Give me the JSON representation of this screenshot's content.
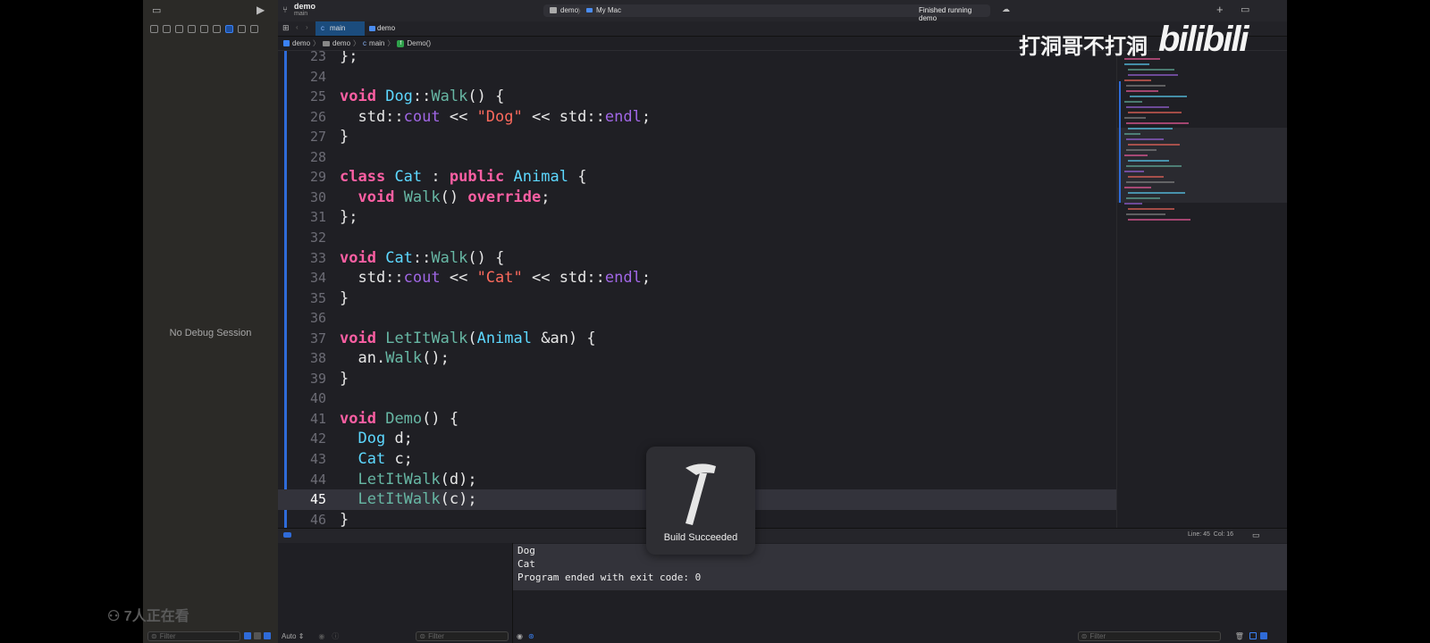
{
  "project": {
    "name": "demo",
    "branch": "main"
  },
  "toolbar": {
    "scheme": "demo",
    "destination": "My Mac",
    "status": "Finished running demo"
  },
  "tabs": [
    {
      "label": "main"
    },
    {
      "label": "demo"
    }
  ],
  "breadcrumb": [
    "demo",
    "demo",
    "main",
    "Demo()"
  ],
  "navigator": {
    "empty_message": "No Debug Session",
    "filter_placeholder": "Filter"
  },
  "editor": {
    "current_line": 45,
    "lines": [
      {
        "n": "23",
        "code": "};"
      },
      {
        "n": "24",
        "code": ""
      },
      {
        "n": "25",
        "code": "void Dog::Walk() {"
      },
      {
        "n": "26",
        "code": "  std::cout << \"Dog\" << std::endl;"
      },
      {
        "n": "27",
        "code": "}"
      },
      {
        "n": "28",
        "code": ""
      },
      {
        "n": "29",
        "code": "class Cat : public Animal {"
      },
      {
        "n": "30",
        "code": "  void Walk() override;"
      },
      {
        "n": "31",
        "code": "};"
      },
      {
        "n": "32",
        "code": ""
      },
      {
        "n": "33",
        "code": "void Cat::Walk() {"
      },
      {
        "n": "34",
        "code": "  std::cout << \"Cat\" << std::endl;"
      },
      {
        "n": "35",
        "code": "}"
      },
      {
        "n": "36",
        "code": ""
      },
      {
        "n": "37",
        "code": "void LetItWalk(Animal &an) {"
      },
      {
        "n": "38",
        "code": "  an.Walk();"
      },
      {
        "n": "39",
        "code": "}"
      },
      {
        "n": "40",
        "code": ""
      },
      {
        "n": "41",
        "code": "void Demo() {"
      },
      {
        "n": "42",
        "code": "  Dog d;"
      },
      {
        "n": "43",
        "code": "  Cat c;"
      },
      {
        "n": "44",
        "code": "  LetItWalk(d);"
      },
      {
        "n": "45",
        "code": "  LetItWalk(c);"
      },
      {
        "n": "46",
        "code": "}"
      }
    ]
  },
  "cursor_position": "Line: 45  Col: 16",
  "debug": {
    "variables_scope": "Auto",
    "filter_placeholder": "Filter"
  },
  "console": {
    "lines": [
      "Dog",
      "Cat",
      "Program ended with exit code: 0"
    ],
    "filter_placeholder": "Filter"
  },
  "hud": {
    "message": "Build Succeeded",
    "icon": "hammer-icon"
  },
  "watermark": {
    "text": "打洞哥不打洞",
    "logo": "bilibili"
  },
  "viewers": "7人正在看",
  "colors": {
    "keyword": "#fc5fa3",
    "function": "#67b7a4",
    "type": "#5dd8ff",
    "string": "#fc6a5d",
    "stdlib": "#a167e6",
    "accent": "#2f6bd8"
  }
}
